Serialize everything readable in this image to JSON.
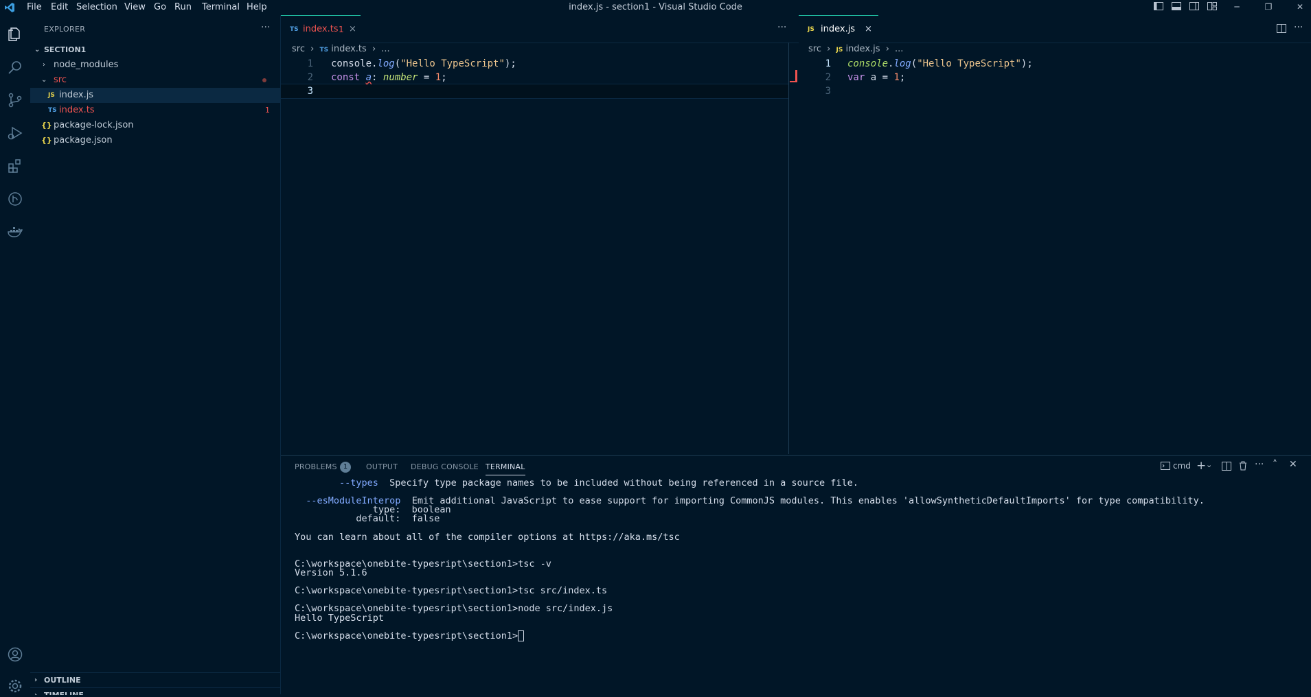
{
  "window": {
    "title": "index.js - section1 - Visual Studio Code"
  },
  "menu": [
    "File",
    "Edit",
    "Selection",
    "View",
    "Go",
    "Run",
    "Terminal",
    "Help"
  ],
  "activity_icons": [
    "explorer-icon",
    "search-icon",
    "source-control-icon",
    "run-debug-icon",
    "extensions-icon",
    "git-graph-icon",
    "docker-icon",
    "account-icon",
    "settings-gear-icon"
  ],
  "sidebar": {
    "header": "EXPLORER",
    "more": "···",
    "root": "SECTION1",
    "items": [
      {
        "label": "node_modules",
        "kind": "folder"
      },
      {
        "label": "src",
        "kind": "folder-open"
      },
      {
        "label": "index.js",
        "kind": "js",
        "icon": "JS"
      },
      {
        "label": "index.ts",
        "kind": "ts",
        "icon": "TS",
        "badge": "1"
      },
      {
        "label": "package-lock.json",
        "kind": "json",
        "icon": "{}"
      },
      {
        "label": "package.json",
        "kind": "json",
        "icon": "{}"
      }
    ],
    "outline": "OUTLINE",
    "timeline": "TIMELINE"
  },
  "editor_left": {
    "tab": {
      "icon": "TS",
      "label": "index.ts",
      "badge": "1",
      "close": "×"
    },
    "more": "···",
    "breadcrumb": {
      "folder": "src",
      "icon": "TS",
      "file": "index.ts",
      "tail": "..."
    },
    "line_numbers": [
      "1",
      "2",
      "3"
    ]
  },
  "editor_right": {
    "tab": {
      "icon": "JS",
      "label": "index.js",
      "close": "×"
    },
    "breadcrumb": {
      "folder": "src",
      "icon": "JS",
      "file": "index.js",
      "tail": "..."
    },
    "line_numbers": [
      "1",
      "2",
      "3"
    ]
  },
  "code_ts": {
    "l1": {
      "obj": "console",
      "dot": ".",
      "fn": "log",
      "p1": "(",
      "str": "\"Hello TypeScript\"",
      "p2": ");"
    },
    "l2": {
      "kw": "const",
      "var": "a",
      "colon": ":",
      "type": "number",
      "eq": " = ",
      "num": "1",
      "semi": ";"
    }
  },
  "code_js": {
    "l1": {
      "obj": "console",
      "dot": ".",
      "fn": "log",
      "p1": "(",
      "str": "\"Hello TypeScript\"",
      "p2": ");"
    },
    "l2": {
      "kw": "var",
      "rest": " a = ",
      "num": "1",
      "semi": ";"
    }
  },
  "panel": {
    "tabs": {
      "problems": "PROBLEMS",
      "problems_count": "1",
      "output": "OUTPUT",
      "debug": "DEBUG CONSOLE",
      "terminal": "TERMINAL"
    },
    "shell": "cmd",
    "terminal": [
      {
        "flag": "        --types",
        "text": "  Specify type package names to be included without being referenced in a source file."
      },
      {
        "flag": "",
        "text": ""
      },
      {
        "flag": "  --esModuleInterop",
        "text": "  Emit additional JavaScript to ease support for importing CommonJS modules. This enables 'allowSyntheticDefaultImports' for type compatibility."
      },
      {
        "flag": "",
        "text": "              type:  boolean"
      },
      {
        "flag": "",
        "text": "           default:  false"
      },
      {
        "flag": "",
        "text": ""
      },
      {
        "flag": "",
        "text": "You can learn about all of the compiler options at https://aka.ms/tsc"
      },
      {
        "flag": "",
        "text": ""
      },
      {
        "flag": "",
        "text": ""
      },
      {
        "flag": "",
        "text": "C:\\workspace\\onebite-typesript\\section1>tsc -v"
      },
      {
        "flag": "",
        "text": "Version 5.1.6"
      },
      {
        "flag": "",
        "text": ""
      },
      {
        "flag": "",
        "text": "C:\\workspace\\onebite-typesript\\section1>tsc src/index.ts"
      },
      {
        "flag": "",
        "text": ""
      },
      {
        "flag": "",
        "text": "C:\\workspace\\onebite-typesript\\section1>node src/index.js"
      },
      {
        "flag": "",
        "text": "Hello TypeScript"
      },
      {
        "flag": "",
        "text": ""
      },
      {
        "flag": "",
        "text": "C:\\workspace\\onebite-typesript\\section1>"
      }
    ]
  }
}
